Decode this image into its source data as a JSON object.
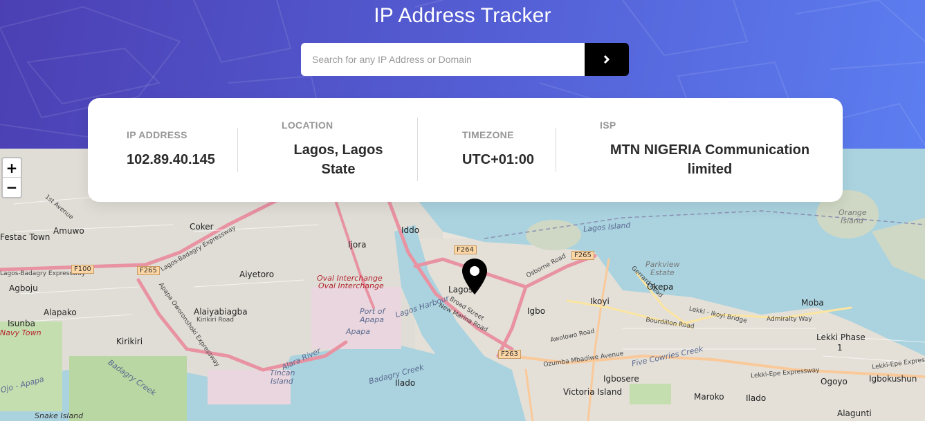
{
  "header": {
    "title": "IP Address Tracker",
    "search": {
      "placeholder": "Search for any IP Address or Domain",
      "value": "",
      "button_icon": "chevron-right-icon"
    },
    "background_colors": [
      "#4b3fb3",
      "#5c7ef0"
    ]
  },
  "info": {
    "ip": {
      "label": "IP ADDRESS",
      "value": "102.89.40.145"
    },
    "location": {
      "label": "LOCATION",
      "value_line1": "Lagos, Lagos",
      "value_line2": "State"
    },
    "timezone": {
      "label": "TIMEZONE",
      "value": "UTC+01:00"
    },
    "isp": {
      "label": "ISP",
      "value_line1": "MTN NIGERIA Communication",
      "value_line2": "limited"
    }
  },
  "map": {
    "zoom_in": "+",
    "zoom_out": "−",
    "marker_icon": "location-pin-icon",
    "labels": {
      "lagos": "Lagos",
      "ikoyi": "Ikoyi",
      "igbo": "Igbo",
      "okepa": "Okepa",
      "moba": "Moba",
      "lekki_phase": "Lekki Phase",
      "lekki_phase_num": "1",
      "victoria_island": "Victoria Island",
      "maroko": "Maroko",
      "ilado_east": "Ilado",
      "igbosere": "Igbosere",
      "ogoyo": "Ogoyo",
      "igbokushun": "Igbokushun",
      "alagunti": "Alagunti",
      "ilado": "Ilado",
      "apapa": "Apapa",
      "port_of": "Port of",
      "port_apapa": "Apapa",
      "ijora": "Ijora",
      "iddo": "Iddo",
      "aiyetoro": "Aiyetoro",
      "alaiyabiagba": "Alaiyabiagba",
      "kirikiri_road": "Kirikiri Road",
      "kirikiri": "Kirikiri",
      "alapako": "Alapako",
      "isunba": "Isunba",
      "navy_town": "Navy Town",
      "agboju": "Agboju",
      "festac_town": "Festac Town",
      "amuwo": "Amuwo",
      "coker": "Coker",
      "tincan": "Tincan",
      "island": "Island",
      "snake_island": "Snake Island",
      "orange": "Orange",
      "orange_island": "Island",
      "parkview": "Parkview",
      "estate": "Estate",
      "lagos_island": "Lagos Island",
      "lagos_harbour": "Lagos Harbour",
      "oval1": "Oval Interchange",
      "oval2": "Oval Interchange",
      "lagos_badagry": "Lagos-Badagry Expressway",
      "badagry_expressway": "Lagos-Badagry Expressway",
      "osborne_road": "Osborne Road",
      "awolowo_road": "Awolowo Road",
      "bourdillon_road": "Bourdillon Road",
      "gerrard_road": "Gerrard Road",
      "lekki_ikoyi_bridge": "Lekki - Ikoyi Bridge",
      "admiralty_way": "Admiralty Way",
      "five_cowries": "Five Cowries Creek",
      "ozumba": "Ozumba Mbadiwe Avenue",
      "lekki_epe": "Lekki-Epe Expressway",
      "lekki_epe2": "Lekki-Epe Expressway",
      "broad_street": "Broad Street",
      "new_marina": "New Marina Road",
      "apapa_oworonshoki": "Apapa Oworonshoki Expressway",
      "badagry_creek": "Badagry Creek",
      "badagry_creek2": "Badagry Creek",
      "ojo_apapa": "Ojo - Apapa",
      "alara_river": "Alara River",
      "f100": "F100",
      "f265a": "F265",
      "f264": "F264",
      "f265b": "F265",
      "f263": "F263",
      "lagos_badagry_expressway_left": "Lagos-Badagry Expressway",
      "first_avenue": "1st Avenue"
    }
  }
}
